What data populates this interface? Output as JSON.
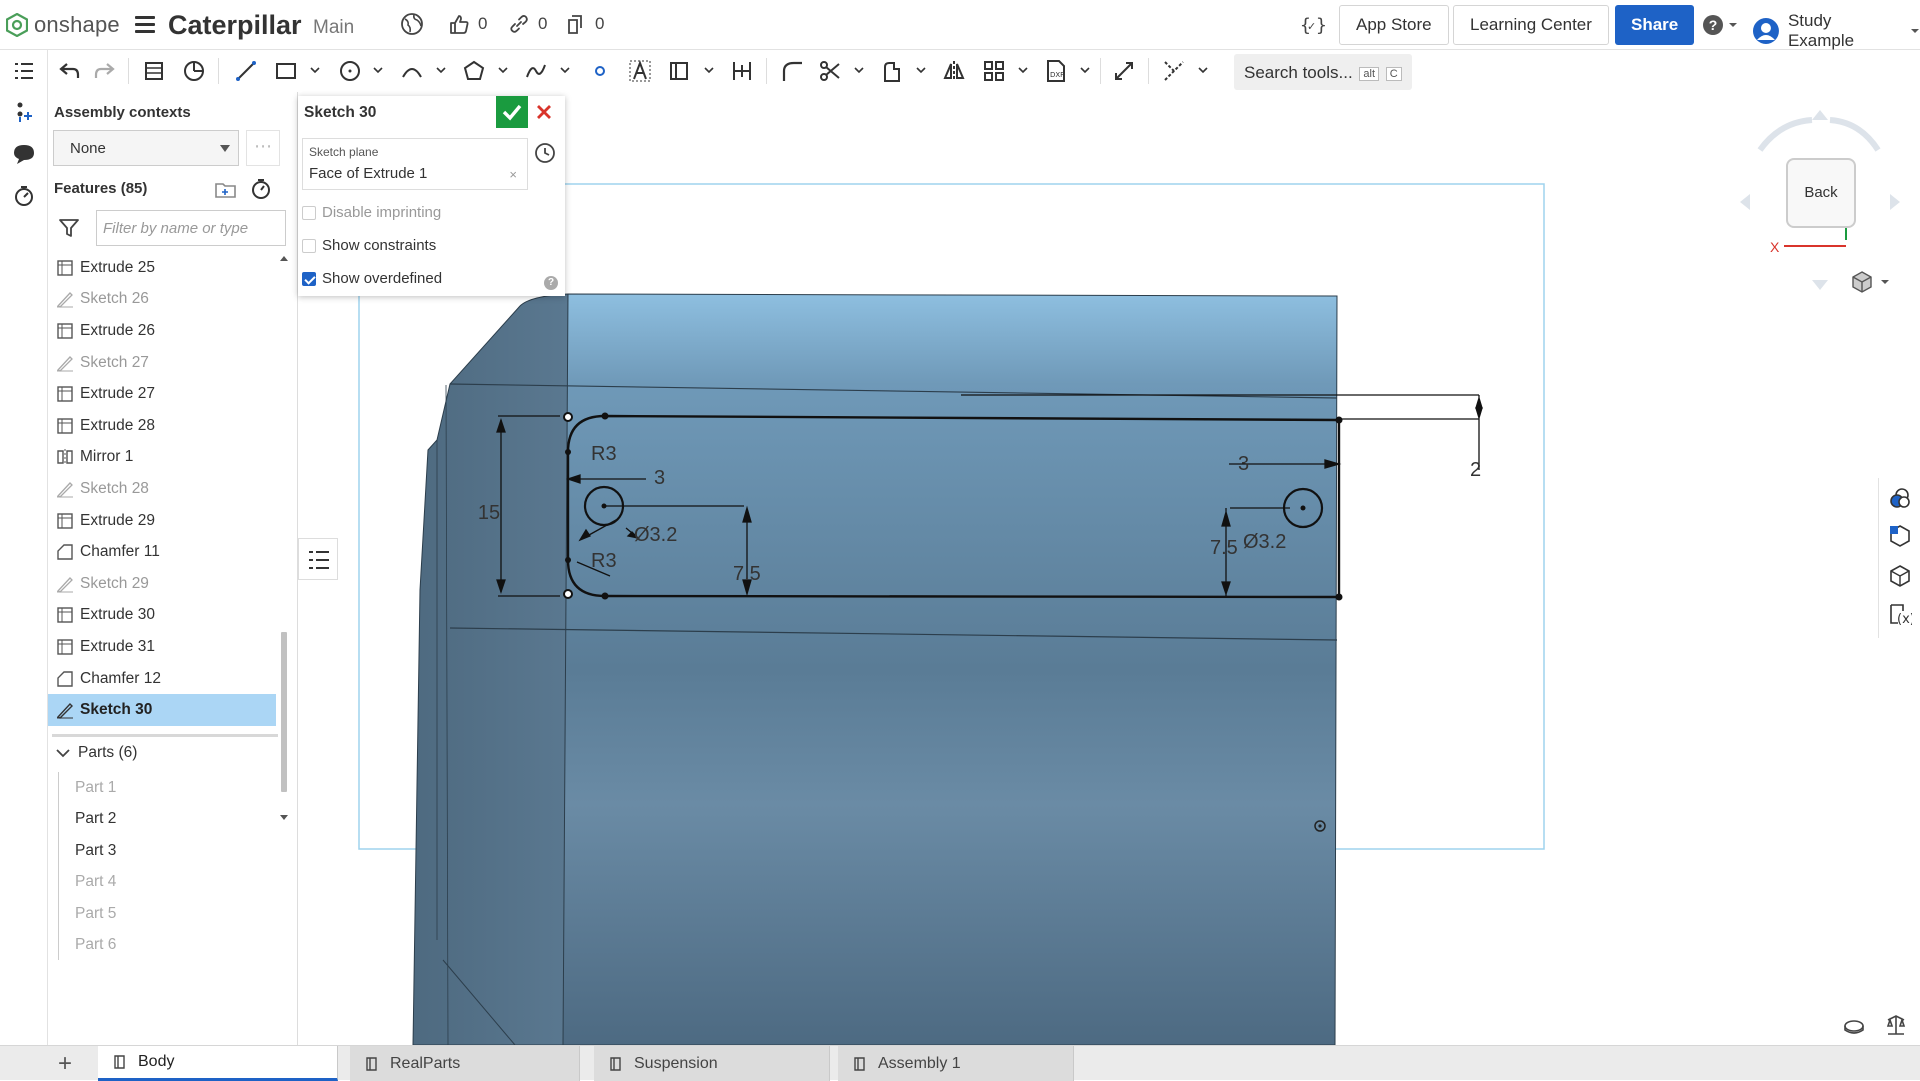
{
  "topbar": {
    "logo_text": "onshape",
    "document_name": "Caterpillar",
    "branch": "Main",
    "likes": "0",
    "links": "0",
    "copies": "0",
    "app_store": "App Store",
    "learning_center": "Learning Center",
    "share": "Share",
    "user_name": "Study Example"
  },
  "toolbar": {
    "search_placeholder": "Search tools...",
    "search_kbd_1": "alt",
    "search_kbd_2": "C"
  },
  "feature_panel": {
    "assembly_contexts_title": "Assembly contexts",
    "assembly_context_value": "None",
    "more_label": "⋯",
    "features_title": "Features (85)",
    "filter_placeholder": "Filter by name or type",
    "features": [
      {
        "label": "Extrude 25",
        "type": "extrude"
      },
      {
        "label": "Sketch 26",
        "type": "sketch"
      },
      {
        "label": "Extrude 26",
        "type": "extrude"
      },
      {
        "label": "Sketch 27",
        "type": "sketch"
      },
      {
        "label": "Extrude 27",
        "type": "extrude"
      },
      {
        "label": "Extrude 28",
        "type": "extrude"
      },
      {
        "label": "Mirror 1",
        "type": "mirror"
      },
      {
        "label": "Sketch 28",
        "type": "sketch"
      },
      {
        "label": "Extrude 29",
        "type": "extrude"
      },
      {
        "label": "Chamfer 11",
        "type": "chamfer"
      },
      {
        "label": "Sketch 29",
        "type": "sketch"
      },
      {
        "label": "Extrude 30",
        "type": "extrude"
      },
      {
        "label": "Extrude 31",
        "type": "extrude"
      },
      {
        "label": "Chamfer 12",
        "type": "chamfer"
      },
      {
        "label": "Sketch 30",
        "type": "sketch",
        "selected": true
      }
    ],
    "parts_title": "Parts (6)",
    "parts": [
      {
        "label": "Part 1",
        "dim": true
      },
      {
        "label": "Part 2",
        "dim": false
      },
      {
        "label": "Part 3",
        "dim": false
      },
      {
        "label": "Part 4",
        "dim": true
      },
      {
        "label": "Part 5",
        "dim": true
      },
      {
        "label": "Part 6",
        "dim": true
      }
    ]
  },
  "sketch_dialog": {
    "title": "Sketch 30",
    "plane_label": "Sketch plane",
    "plane_value": "Face of Extrude 1",
    "plane_clear": "×",
    "disable_imprinting": "Disable imprinting",
    "show_constraints": "Show constraints",
    "show_overdefined": "Show overdefined",
    "disable_imprinting_checked": false,
    "show_constraints_checked": false,
    "show_overdefined_checked": true,
    "help": "?"
  },
  "viewport": {
    "dimensions": {
      "height_15": "15",
      "radius_top": "R3",
      "radius_bottom": "R3",
      "offset_left": "3",
      "offset_right": "3",
      "hole_left": "Ø3.2",
      "hole_right": "Ø3.2",
      "vert_left": "7.5",
      "vert_right": "7.5",
      "gap_2": "2"
    },
    "body_color": "#5d7d95"
  },
  "view_cube": {
    "face_label": "Back",
    "axis_x": "X",
    "axis_z": "Z"
  },
  "tabs": [
    {
      "label": "Body",
      "active": true
    },
    {
      "label": "RealParts",
      "active": false
    },
    {
      "label": "Suspension",
      "active": false
    },
    {
      "label": "Assembly 1",
      "active": false
    }
  ],
  "colors": {
    "accent": "#1e62c6",
    "ok_green": "#1a9b3f",
    "cancel_red": "#d9342b",
    "selection": "#abd6f5"
  }
}
